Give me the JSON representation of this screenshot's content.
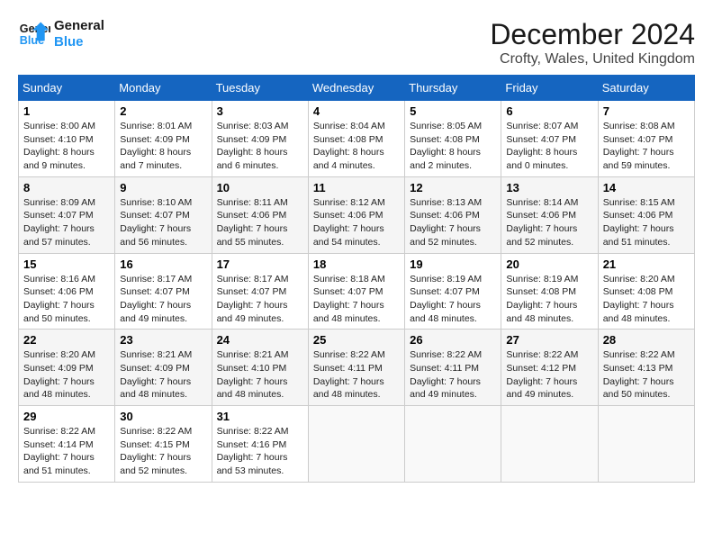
{
  "logo": {
    "line1": "General",
    "line2": "Blue"
  },
  "title": "December 2024",
  "location": "Crofty, Wales, United Kingdom",
  "headers": [
    "Sunday",
    "Monday",
    "Tuesday",
    "Wednesday",
    "Thursday",
    "Friday",
    "Saturday"
  ],
  "weeks": [
    [
      {
        "day": "1",
        "sunrise": "8:00 AM",
        "sunset": "4:10 PM",
        "daylight": "8 hours and 9 minutes."
      },
      {
        "day": "2",
        "sunrise": "8:01 AM",
        "sunset": "4:09 PM",
        "daylight": "8 hours and 7 minutes."
      },
      {
        "day": "3",
        "sunrise": "8:03 AM",
        "sunset": "4:09 PM",
        "daylight": "8 hours and 6 minutes."
      },
      {
        "day": "4",
        "sunrise": "8:04 AM",
        "sunset": "4:08 PM",
        "daylight": "8 hours and 4 minutes."
      },
      {
        "day": "5",
        "sunrise": "8:05 AM",
        "sunset": "4:08 PM",
        "daylight": "8 hours and 2 minutes."
      },
      {
        "day": "6",
        "sunrise": "8:07 AM",
        "sunset": "4:07 PM",
        "daylight": "8 hours and 0 minutes."
      },
      {
        "day": "7",
        "sunrise": "8:08 AM",
        "sunset": "4:07 PM",
        "daylight": "7 hours and 59 minutes."
      }
    ],
    [
      {
        "day": "8",
        "sunrise": "8:09 AM",
        "sunset": "4:07 PM",
        "daylight": "7 hours and 57 minutes."
      },
      {
        "day": "9",
        "sunrise": "8:10 AM",
        "sunset": "4:07 PM",
        "daylight": "7 hours and 56 minutes."
      },
      {
        "day": "10",
        "sunrise": "8:11 AM",
        "sunset": "4:06 PM",
        "daylight": "7 hours and 55 minutes."
      },
      {
        "day": "11",
        "sunrise": "8:12 AM",
        "sunset": "4:06 PM",
        "daylight": "7 hours and 54 minutes."
      },
      {
        "day": "12",
        "sunrise": "8:13 AM",
        "sunset": "4:06 PM",
        "daylight": "7 hours and 52 minutes."
      },
      {
        "day": "13",
        "sunrise": "8:14 AM",
        "sunset": "4:06 PM",
        "daylight": "7 hours and 52 minutes."
      },
      {
        "day": "14",
        "sunrise": "8:15 AM",
        "sunset": "4:06 PM",
        "daylight": "7 hours and 51 minutes."
      }
    ],
    [
      {
        "day": "15",
        "sunrise": "8:16 AM",
        "sunset": "4:06 PM",
        "daylight": "7 hours and 50 minutes."
      },
      {
        "day": "16",
        "sunrise": "8:17 AM",
        "sunset": "4:07 PM",
        "daylight": "7 hours and 49 minutes."
      },
      {
        "day": "17",
        "sunrise": "8:17 AM",
        "sunset": "4:07 PM",
        "daylight": "7 hours and 49 minutes."
      },
      {
        "day": "18",
        "sunrise": "8:18 AM",
        "sunset": "4:07 PM",
        "daylight": "7 hours and 48 minutes."
      },
      {
        "day": "19",
        "sunrise": "8:19 AM",
        "sunset": "4:07 PM",
        "daylight": "7 hours and 48 minutes."
      },
      {
        "day": "20",
        "sunrise": "8:19 AM",
        "sunset": "4:08 PM",
        "daylight": "7 hours and 48 minutes."
      },
      {
        "day": "21",
        "sunrise": "8:20 AM",
        "sunset": "4:08 PM",
        "daylight": "7 hours and 48 minutes."
      }
    ],
    [
      {
        "day": "22",
        "sunrise": "8:20 AM",
        "sunset": "4:09 PM",
        "daylight": "7 hours and 48 minutes."
      },
      {
        "day": "23",
        "sunrise": "8:21 AM",
        "sunset": "4:09 PM",
        "daylight": "7 hours and 48 minutes."
      },
      {
        "day": "24",
        "sunrise": "8:21 AM",
        "sunset": "4:10 PM",
        "daylight": "7 hours and 48 minutes."
      },
      {
        "day": "25",
        "sunrise": "8:22 AM",
        "sunset": "4:11 PM",
        "daylight": "7 hours and 48 minutes."
      },
      {
        "day": "26",
        "sunrise": "8:22 AM",
        "sunset": "4:11 PM",
        "daylight": "7 hours and 49 minutes."
      },
      {
        "day": "27",
        "sunrise": "8:22 AM",
        "sunset": "4:12 PM",
        "daylight": "7 hours and 49 minutes."
      },
      {
        "day": "28",
        "sunrise": "8:22 AM",
        "sunset": "4:13 PM",
        "daylight": "7 hours and 50 minutes."
      }
    ],
    [
      {
        "day": "29",
        "sunrise": "8:22 AM",
        "sunset": "4:14 PM",
        "daylight": "7 hours and 51 minutes."
      },
      {
        "day": "30",
        "sunrise": "8:22 AM",
        "sunset": "4:15 PM",
        "daylight": "7 hours and 52 minutes."
      },
      {
        "day": "31",
        "sunrise": "8:22 AM",
        "sunset": "4:16 PM",
        "daylight": "7 hours and 53 minutes."
      },
      null,
      null,
      null,
      null
    ]
  ]
}
